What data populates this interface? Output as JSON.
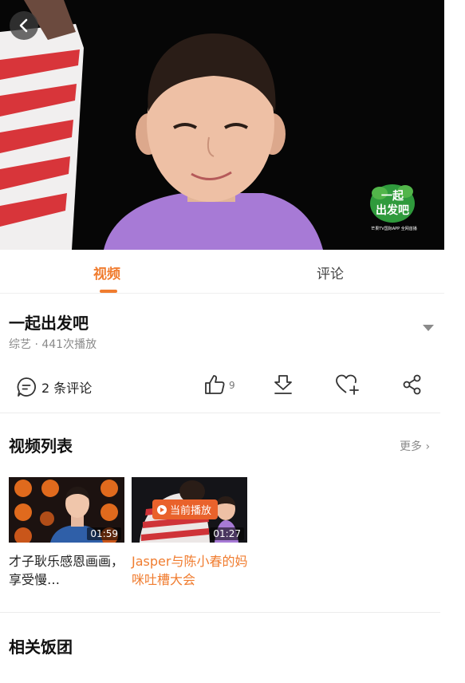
{
  "video": {
    "logo_line1": "一起",
    "logo_line2": "出发吧",
    "logo_sub": "芒果TV国际APP 全网首播"
  },
  "tabs": [
    {
      "label": "视频",
      "active": true
    },
    {
      "label": "评论",
      "active": false
    }
  ],
  "info": {
    "title": "一起出发吧",
    "meta": "综艺 · 441次播放"
  },
  "actions": {
    "comments_label": "2 条评论",
    "likes_count": "9",
    "icons": [
      "comment-bubble",
      "thumbs-up",
      "download-arrow",
      "heart-plus",
      "share"
    ]
  },
  "video_list": {
    "title": "视频列表",
    "more_label": "更多",
    "items": [
      {
        "caption": "才子耿乐感恩画画，享受慢…",
        "duration": "01:59",
        "current": false
      },
      {
        "caption": "Jasper与陈小春的妈咪吐槽大会",
        "duration": "01:27",
        "current": true,
        "badge": "当前播放"
      }
    ]
  },
  "related": {
    "title": "相关饭团"
  },
  "colors": {
    "accent": "#f07c2f",
    "badge": "#e9622b",
    "muted": "#8a8a8a"
  }
}
